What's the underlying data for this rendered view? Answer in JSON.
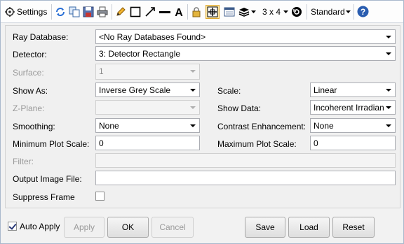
{
  "toolbar": {
    "settings_label": "Settings",
    "grid_label": "3 x 4",
    "standard_label": "Standard",
    "icons": [
      "settings-icon",
      "refresh-icon",
      "copy-icon",
      "save-icon",
      "print-icon",
      "pencil-icon",
      "rectangle-icon",
      "arrow-line-icon",
      "line-icon",
      "text-icon",
      "lock-icon",
      "crosshair-icon",
      "window-icon",
      "layers-icon",
      "reset-icon",
      "help-icon"
    ]
  },
  "form": {
    "ray_database": {
      "label": "Ray Database:",
      "value": "<No Ray Databases Found>"
    },
    "detector": {
      "label": "Detector:",
      "value": "3: Detector Rectangle"
    },
    "surface": {
      "label": "Surface:",
      "value": "1"
    },
    "show_as": {
      "label": "Show As:",
      "value": "Inverse Grey Scale"
    },
    "scale": {
      "label": "Scale:",
      "value": "Linear"
    },
    "z_plane": {
      "label": "Z-Plane:",
      "value": ""
    },
    "show_data": {
      "label": "Show Data:",
      "value": "Incoherent Irradian"
    },
    "smoothing": {
      "label": "Smoothing:",
      "value": "None"
    },
    "contrast_enhancement": {
      "label": "Contrast Enhancement:",
      "value": "None"
    },
    "min_plot_scale": {
      "label": "Minimum Plot Scale:",
      "value": "0"
    },
    "max_plot_scale": {
      "label": "Maximum Plot Scale:",
      "value": "0"
    },
    "filter": {
      "label": "Filter:",
      "value": ""
    },
    "output_image_file": {
      "label": "Output Image File:",
      "value": ""
    },
    "suppress_frame": {
      "label": "Suppress Frame",
      "checked": false
    }
  },
  "footer": {
    "auto_apply": {
      "label": "Auto Apply",
      "checked": true
    },
    "apply_label": "Apply",
    "ok_label": "OK",
    "cancel_label": "Cancel",
    "save_label": "Save",
    "load_label": "Load",
    "reset_label": "Reset"
  },
  "colors": {
    "accent": "#2a5db0",
    "border": "#a9b8cc",
    "panel_bg": "#f0f0f0"
  }
}
